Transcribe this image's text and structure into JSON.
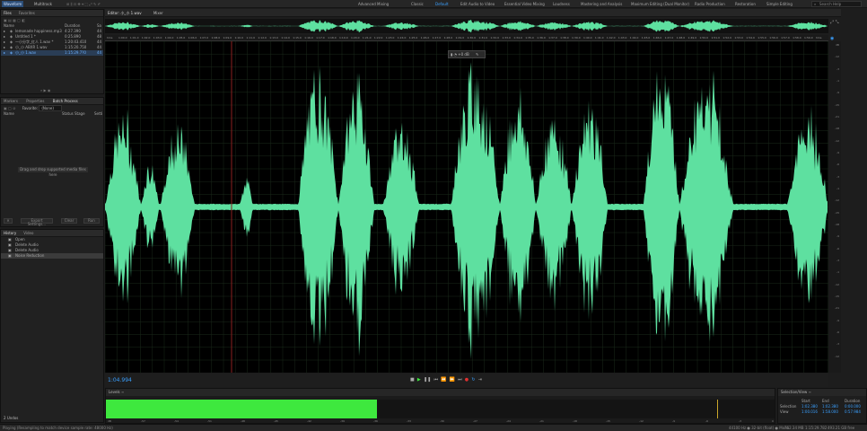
{
  "topbar": {
    "modes": [
      "Waveform",
      "Multitrack"
    ],
    "workspaces": [
      "Advanced Mixing",
      "Classic",
      "Default",
      "Edit Audio to Video",
      "Essential Video Mixing",
      "Loudness",
      "Mastering and Analysis",
      "Maximum Editing (Dual Monitor)",
      "Radio Production",
      "Restoration",
      "Simple Editing"
    ],
    "active_workspace": "Default",
    "search_placeholder": "Search Help"
  },
  "files_panel": {
    "tabs": [
      "Files",
      "Favorites"
    ],
    "headers": {
      "name": "Name",
      "duration": "Duration",
      "sr": "Sa"
    },
    "files": [
      {
        "name": "lemonade happiness.mp3",
        "duration": "4:27.390",
        "sr": "44"
      },
      {
        "name": "Untitled 1 *",
        "duration": "0:25.890",
        "sr": "48"
      },
      {
        "name": "一小分字_红人 1.wav *",
        "duration": "1:20:43.410",
        "sr": "44"
      },
      {
        "name": "小_小 ABXR 1.wav",
        "duration": "1:15:20.750",
        "sr": "44"
      },
      {
        "name": "小_小 1.wav",
        "duration": "1:15:29.7?0",
        "sr": "44"
      }
    ]
  },
  "batch_panel": {
    "tabs": [
      "Markers",
      "Properties",
      "Batch Process"
    ],
    "favorite_label": "Favorite:",
    "favorite_value": "(None)",
    "headers": {
      "name": "Name",
      "status": "Status",
      "stage": "Stage",
      "settings": "Setti"
    },
    "drop_hint": "Drag and drop supported media files here",
    "buttons": [
      "Export Settings...",
      "Clear",
      "Run"
    ]
  },
  "history_panel": {
    "tabs": [
      "History",
      "Video"
    ],
    "items": [
      "Open",
      "Delete Audio",
      "Delete Audio",
      "Noise Reduction"
    ],
    "undo_count": "2 Undos"
  },
  "editor": {
    "tabs": [
      "Editor: 小_小 1.wav",
      "Mixer"
    ],
    "ruler_labels": [
      "hms",
      "1:00.0",
      "1:01.0",
      "1:02.0",
      "1:03.0",
      "1:04.0",
      "1:05.0",
      "1:06.0",
      "1:07.0",
      "1:08.0",
      "1:09.0",
      "1:10.0",
      "1:11.0",
      "1:12.0",
      "1:13.0",
      "1:14.0",
      "1:15.0",
      "1:16.0",
      "1:17.0",
      "1:18.0",
      "1:19.0",
      "1:20.0",
      "1:21.0",
      "1:22.0",
      "1:23.0",
      "1:24.0",
      "1:25.0",
      "1:26.0",
      "1:27.0",
      "1:28.0",
      "1:29.0",
      "1:30.0",
      "1:31.0",
      "1:32.0",
      "1:33.0",
      "1:34.0",
      "1:35.0",
      "1:36.0",
      "1:37.0",
      "1:38.0",
      "1:39.0",
      "1:40.0",
      "1:41.0",
      "1:42.0",
      "1:43.0",
      "1:44.0",
      "1:45.0",
      "1:46.0",
      "1:47.0",
      "1:48.0",
      "1:49.0",
      "1:50.0",
      "1:51.0",
      "1:52.0",
      "1:53.0",
      "1:54.0",
      "1:55.0",
      "1:56.0",
      "1:57.0",
      "1:58.0",
      "1:59.0",
      "hms"
    ],
    "hud_value": "+0 dB",
    "db_scale": [
      "dB",
      "-12",
      "-3",
      "-1",
      "-9",
      "-15",
      "-21",
      "-18",
      "-12",
      "-9",
      "-6",
      "-3",
      "-1",
      "-12",
      "-15",
      "-18",
      "-9",
      "-6",
      "-3",
      "-1",
      "-12",
      "-15",
      "-21",
      "-9",
      "-6",
      "-3",
      "-12"
    ],
    "current_time": "1:04.994"
  },
  "levels": {
    "title": "Levels",
    "scale": [
      "dB",
      "-57",
      "-54",
      "-51",
      "-48",
      "-45",
      "-42",
      "-39",
      "-36",
      "-33",
      "-30",
      "-27",
      "-24",
      "-21",
      "-18",
      "-15",
      "-12",
      "-9",
      "-6",
      "-3",
      "0"
    ],
    "level_fraction": 0.405
  },
  "selection_view": {
    "title": "Selection/View",
    "headers": [
      "Start",
      "End",
      "Duration"
    ],
    "rows": [
      {
        "label": "Selection",
        "start": "1:02.380",
        "end": "1:02.380",
        "duration": "0:00.000"
      },
      {
        "label": "View",
        "start": "1:00.016",
        "end": "1:58.000",
        "duration": "0:57.984"
      }
    ]
  },
  "status": {
    "left": "Playing (Resampling to match device sample rate: 48000 Hz)",
    "right": [
      "44100 Hz ● 32-bit (float) ● Mono",
      "762.34 MB",
      "1:15:29.782",
      "493.21 GB free"
    ]
  },
  "colors": {
    "waveform": "#5ee0a0",
    "level": "#3ee83e",
    "accent": "#3aa0ff",
    "playhead": "#8b2020"
  }
}
